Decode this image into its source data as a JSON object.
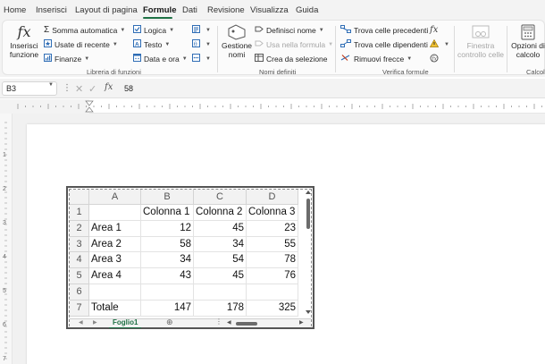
{
  "tabs": [
    {
      "label": "Home",
      "active": false
    },
    {
      "label": "Inserisci",
      "active": false
    },
    {
      "label": "Layout di pagina",
      "active": false
    },
    {
      "label": "Formule",
      "active": true
    },
    {
      "label": "Dati",
      "active": false
    },
    {
      "label": "Revisione",
      "active": false
    },
    {
      "label": "Visualizza",
      "active": false
    },
    {
      "label": "Guida",
      "active": false
    }
  ],
  "ribbon": {
    "insert_function": "Inserisci funzione",
    "autosum": "Somma automatica",
    "recent": "Usate di recente",
    "finance": "Finanze",
    "logical": "Logica",
    "text": "Testo",
    "datetime": "Data e ora",
    "group_library": "Libreria di funzioni",
    "name_manager": "Gestione nomi",
    "define_name": "Definisci nome",
    "use_in_formula": "Usa nella formula",
    "create_from_selection": "Crea da selezione",
    "group_names": "Nomi definiti",
    "trace_precedents": "Trova celle precedenti",
    "trace_dependents": "Trova celle dipendenti",
    "remove_arrows": "Rimuovi frecce",
    "group_audit": "Verifica formule",
    "watch_window": "Finestra controllo celle",
    "calc_options": "Opzioni di calcolo",
    "group_calc": "Calcolo"
  },
  "formula_bar": {
    "name_box": "B3",
    "fx": "fx",
    "value": "58"
  },
  "sheet": {
    "columns": [
      "A",
      "B",
      "C",
      "D"
    ],
    "rows": [
      {
        "num": "1",
        "cells": [
          "",
          "Colonna 1",
          "Colonna 2",
          "Colonna 3"
        ]
      },
      {
        "num": "2",
        "cells": [
          "Area 1",
          "12",
          "45",
          "23"
        ]
      },
      {
        "num": "3",
        "cells": [
          "Area 2",
          "58",
          "34",
          "55"
        ]
      },
      {
        "num": "4",
        "cells": [
          "Area 3",
          "34",
          "54",
          "78"
        ]
      },
      {
        "num": "5",
        "cells": [
          "Area 4",
          "43",
          "45",
          "76"
        ]
      },
      {
        "num": "6",
        "cells": [
          "",
          "",
          "",
          ""
        ]
      },
      {
        "num": "7",
        "cells": [
          "Totale",
          "147",
          "178",
          "325"
        ]
      }
    ],
    "sheet_tab": "Foglio1"
  },
  "colors": {
    "accent": "#1e7145",
    "ribbon_bg": "#f3f3f3"
  }
}
